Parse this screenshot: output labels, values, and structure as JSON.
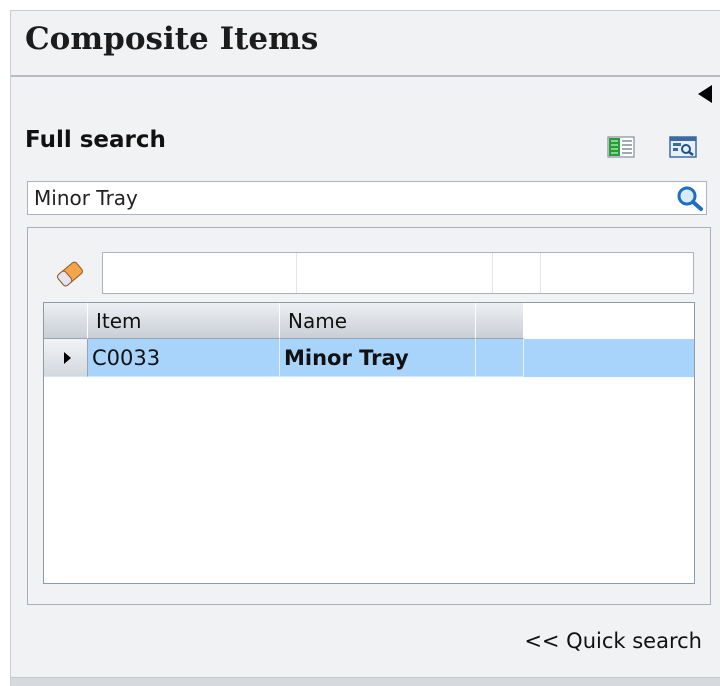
{
  "header": {
    "title": "Composite Items"
  },
  "section": {
    "title": "Full search"
  },
  "search": {
    "value": "Minor Tray"
  },
  "grid": {
    "columns": [
      "Item",
      "Name"
    ],
    "rows": [
      {
        "item": "C0033",
        "name": "Minor Tray"
      }
    ]
  },
  "footer": {
    "quick_search_label": "<< Quick search"
  },
  "icons": {
    "collapse": "collapse-arrow-icon",
    "grid_view": "grid-layout-icon",
    "search_config": "search-settings-icon",
    "search": "magnifier-icon",
    "clear_filter": "eraser-icon",
    "row_selector": "current-row-arrow-icon"
  },
  "colors": {
    "panel_bg": "#f1f2f4",
    "selected_row": "#a8d4fb",
    "search_icon": "#1d6fc4",
    "grid_icon_green": "#2a9a3a"
  }
}
